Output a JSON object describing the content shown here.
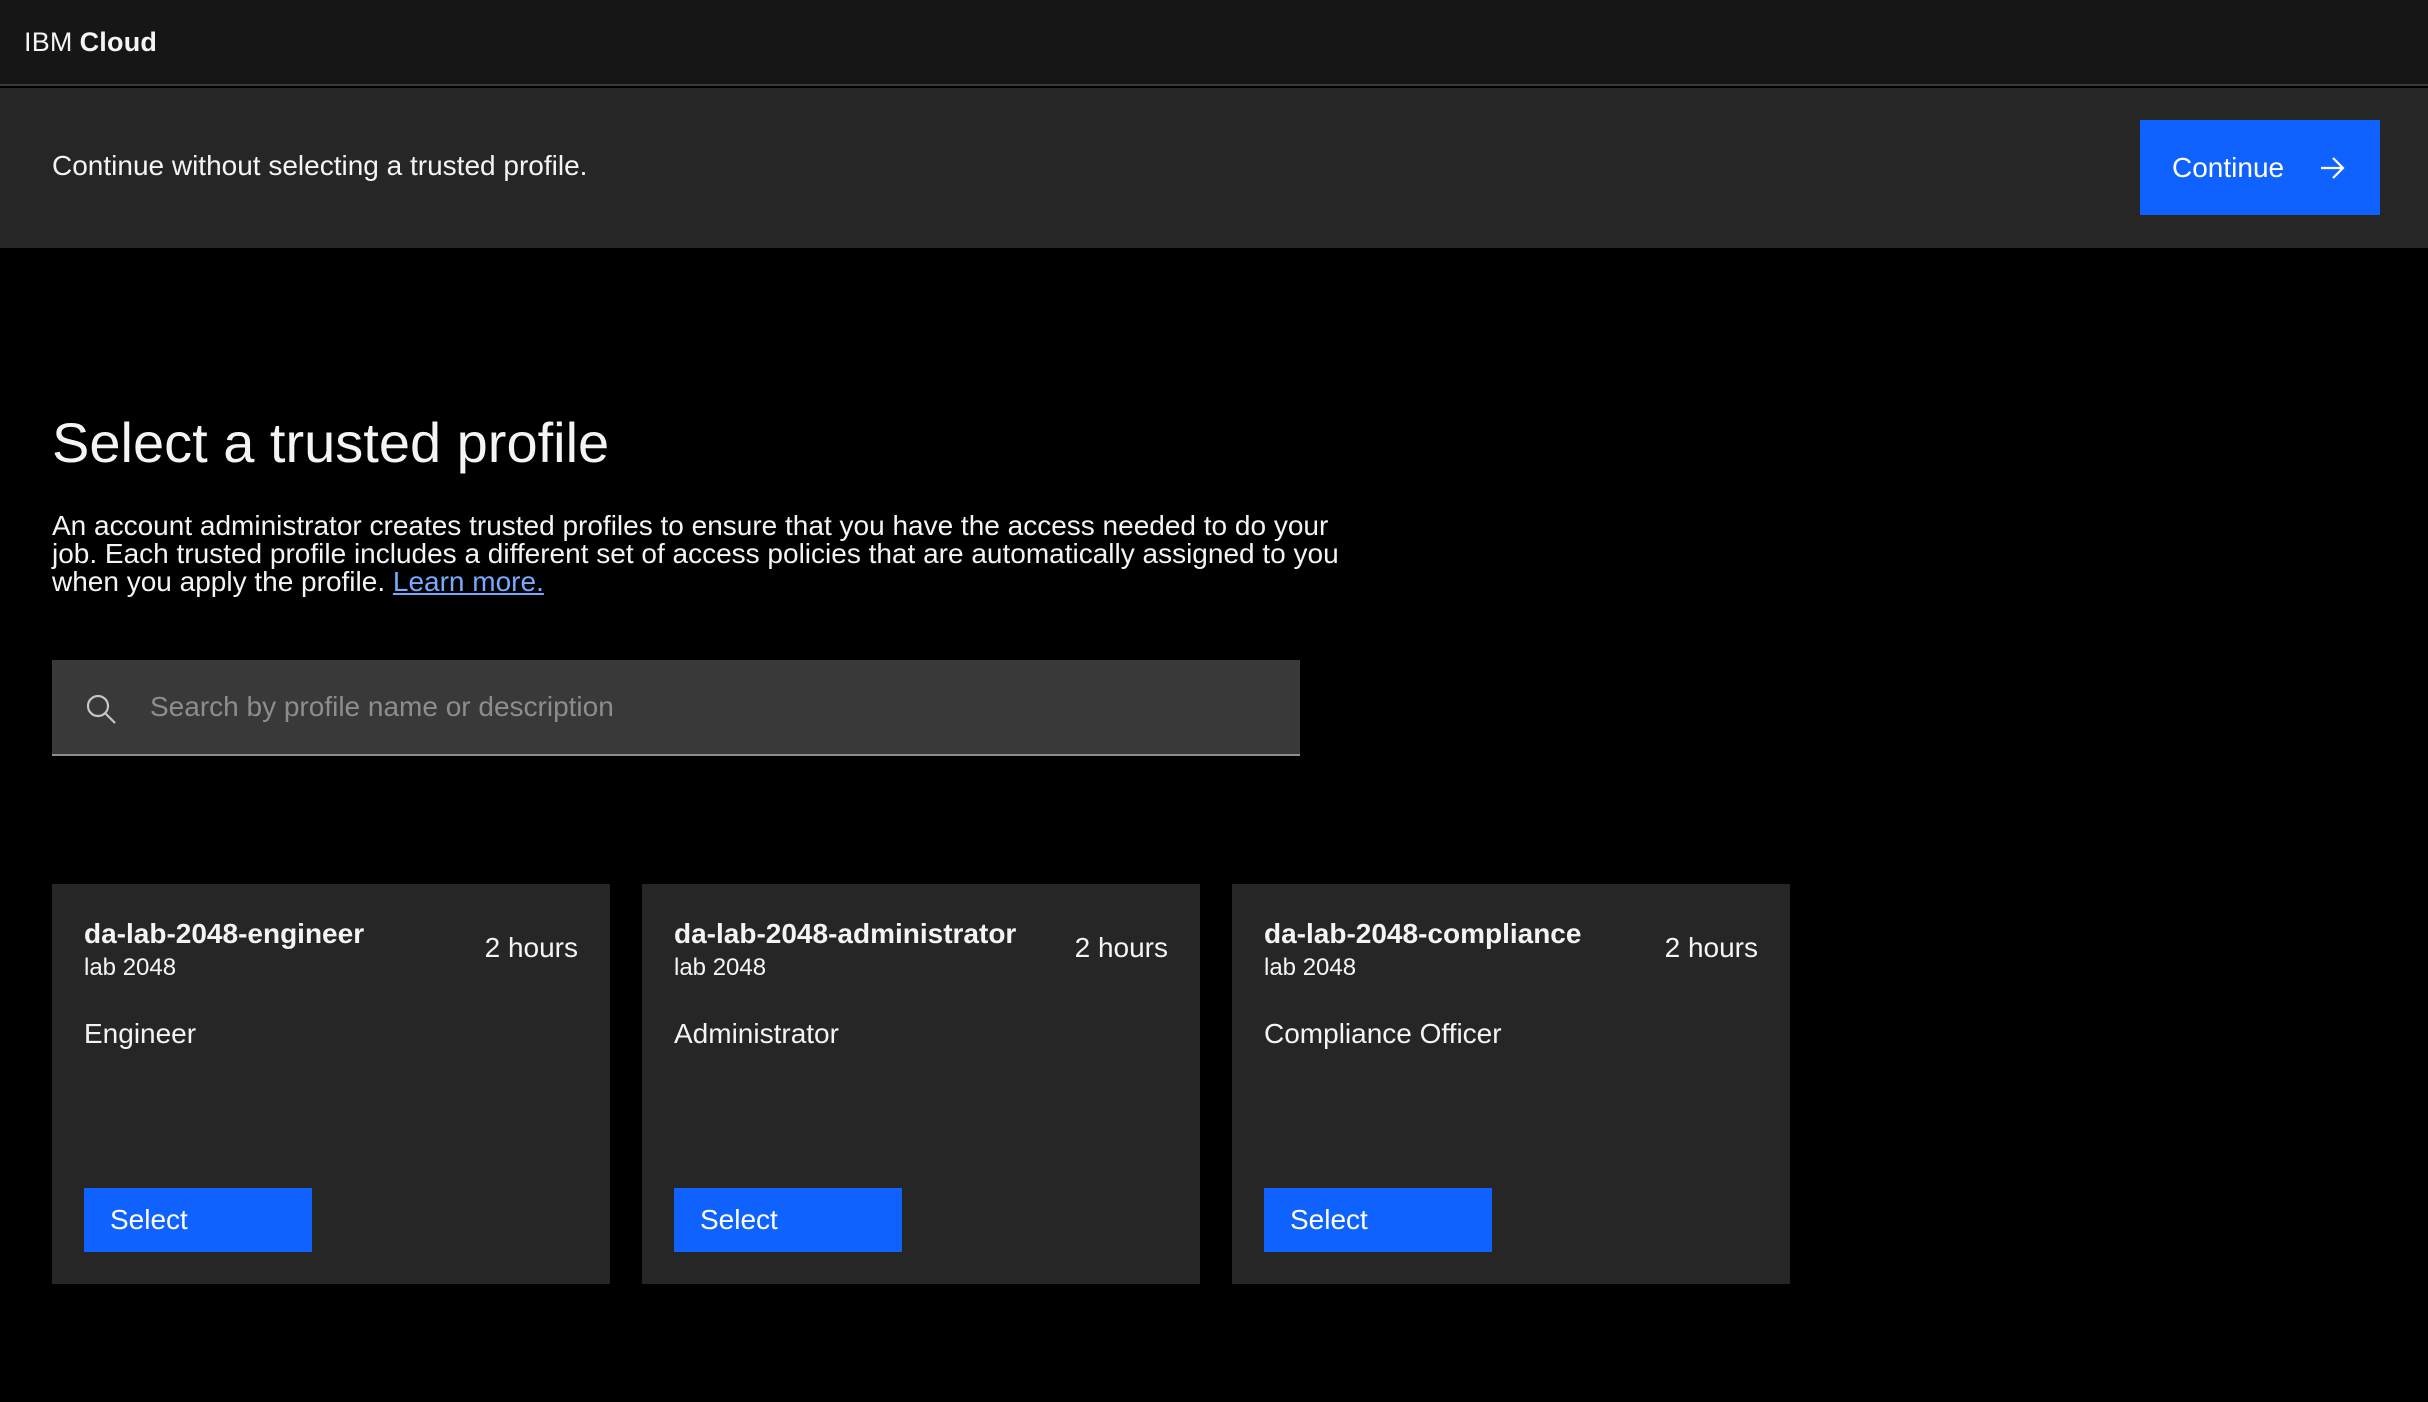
{
  "header": {
    "brand_prefix": "IBM",
    "brand_name": "Cloud"
  },
  "banner": {
    "text": "Continue without selecting a trusted profile.",
    "continue_label": "Continue",
    "continue_icon": "arrow-right-icon"
  },
  "main": {
    "title": "Select a trusted profile",
    "description": "An account administrator creates trusted profiles to ensure that you have the access needed to do your job. Each trusted profile includes a different set of access policies that are automatically assigned to you when you apply the profile.",
    "learn_more": "Learn more.",
    "search": {
      "placeholder": "Search by profile name or description",
      "value": "",
      "icon": "search-icon"
    }
  },
  "profiles": [
    {
      "name": "da-lab-2048-engineer",
      "subtitle": "lab 2048",
      "duration": "2 hours",
      "description": "Engineer",
      "select_label": "Select"
    },
    {
      "name": "da-lab-2048-administrator",
      "subtitle": "lab 2048",
      "duration": "2 hours",
      "description": "Administrator",
      "select_label": "Select"
    },
    {
      "name": "da-lab-2048-compliance",
      "subtitle": "lab 2048",
      "duration": "2 hours",
      "description": "Compliance Officer",
      "select_label": "Select"
    }
  ],
  "colors": {
    "background": "#000000",
    "header": "#161616",
    "surface": "#262626",
    "field": "#393939",
    "primary_button": "#0f62fe",
    "link": "#78a9ff",
    "text": "#f4f4f4",
    "placeholder": "#8d8d8d"
  }
}
